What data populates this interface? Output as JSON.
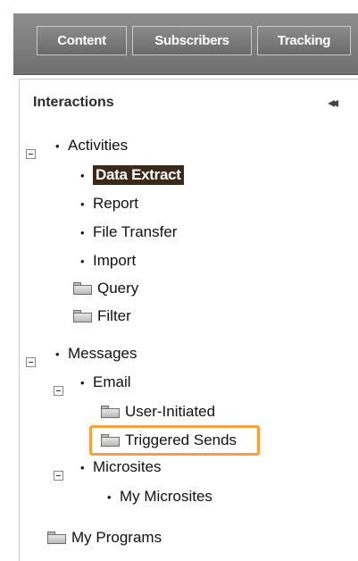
{
  "top_tabs": [
    "Content",
    "Subscribers",
    "Tracking"
  ],
  "panel": {
    "title": "Interactions",
    "collapse_glyph": "◂◂"
  },
  "tree": {
    "activities": "Activities",
    "data_extract": "Data Extract",
    "report": "Report",
    "file_transfer": "File Transfer",
    "import": "Import",
    "query": "Query",
    "filter": "Filter",
    "messages": "Messages",
    "email": "Email",
    "user_initiated": "User-Initiated",
    "triggered_sends": "Triggered Sends",
    "microsites": "Microsites",
    "my_microsites": "My Microsites",
    "my_programs": "My Programs"
  },
  "colors": {
    "selected_bg": "#3b2a1a",
    "highlight_border": "#f4a23a"
  }
}
